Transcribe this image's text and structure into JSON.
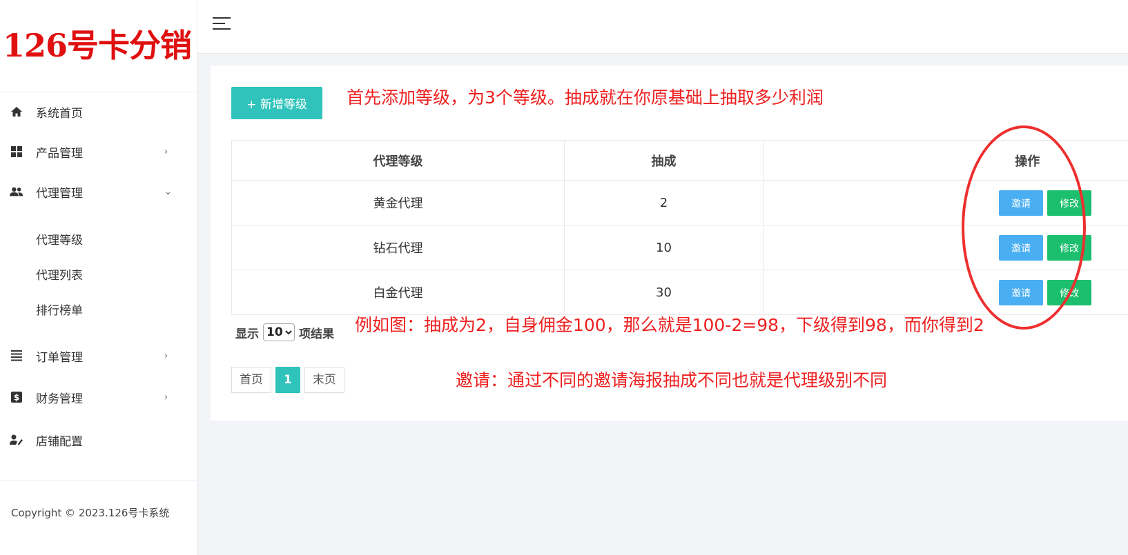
{
  "logo": {
    "text": "126号卡分销"
  },
  "sidebar": {
    "items": [
      {
        "label": "系统首页",
        "icon": "home-icon"
      },
      {
        "label": "产品管理",
        "icon": "grid-icon",
        "chevron": "›"
      },
      {
        "label": "代理管理",
        "icon": "users-icon",
        "chevron": "⌄"
      },
      {
        "label": "订单管理",
        "icon": "list-icon",
        "chevron": "›"
      },
      {
        "label": "财务管理",
        "icon": "finance-icon",
        "chevron": "›"
      },
      {
        "label": "店铺配置",
        "icon": "user-edit-icon"
      }
    ],
    "subitems": [
      "代理等级",
      "代理列表",
      "排行榜单"
    ],
    "copyright": "Copyright © 2023.126号卡系统"
  },
  "toolbar": {
    "add_label": "+ 新增等级"
  },
  "annotations": {
    "top": "首先添加等级，为3个等级。抽成就在你原基础上抽取多少利润",
    "middle": "例如图：抽成为2，自身佣金100，那么就是100-2=98，下级得到98，而你得到2",
    "bottom": "邀请：通过不同的邀请海报抽成不同也就是代理级别不同"
  },
  "table": {
    "headers": [
      "代理等级",
      "抽成",
      "操作"
    ],
    "rows": [
      {
        "level": "黄金代理",
        "rate": "2"
      },
      {
        "level": "钻石代理",
        "rate": "10"
      },
      {
        "level": "白金代理",
        "rate": "30"
      }
    ],
    "invite_label": "邀请",
    "edit_label": "修改"
  },
  "pagination": {
    "show_label": "显示",
    "per_page": "10",
    "suffix_label": "项结果",
    "first": "首页",
    "current": "1",
    "last": "末页"
  },
  "colors": {
    "accent": "#2fc3bb",
    "invite": "#4aaef2",
    "edit": "#1cbf6d",
    "annotation": "#ee2020",
    "logo": "#e01010"
  }
}
